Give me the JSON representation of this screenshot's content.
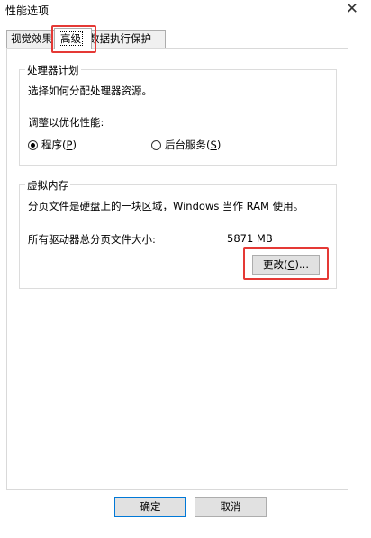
{
  "window": {
    "title": "性能选项"
  },
  "tabs": [
    {
      "label": "视觉效果"
    },
    {
      "label": "高级"
    },
    {
      "label": "数据执行保护"
    }
  ],
  "processor": {
    "group_label": "处理器计划",
    "description": "选择如何分配处理器资源。",
    "adjust_label": "调整以优化性能:",
    "option_programs": {
      "text": "程序(",
      "key": "P",
      "end": ")"
    },
    "option_background": {
      "text": "后台服务(",
      "key": "S",
      "end": ")"
    },
    "selected": "programs"
  },
  "virtual_memory": {
    "group_label": "虚拟内存",
    "description": "分页文件是硬盘上的一块区域，Windows 当作 RAM 使用。",
    "total_label": "所有驱动器总分页文件大小:",
    "total_value": "5871 MB",
    "change_button": {
      "text": "更改(",
      "key": "C",
      "end": ")..."
    }
  },
  "footer": {
    "ok": "确定",
    "cancel": "取消"
  }
}
